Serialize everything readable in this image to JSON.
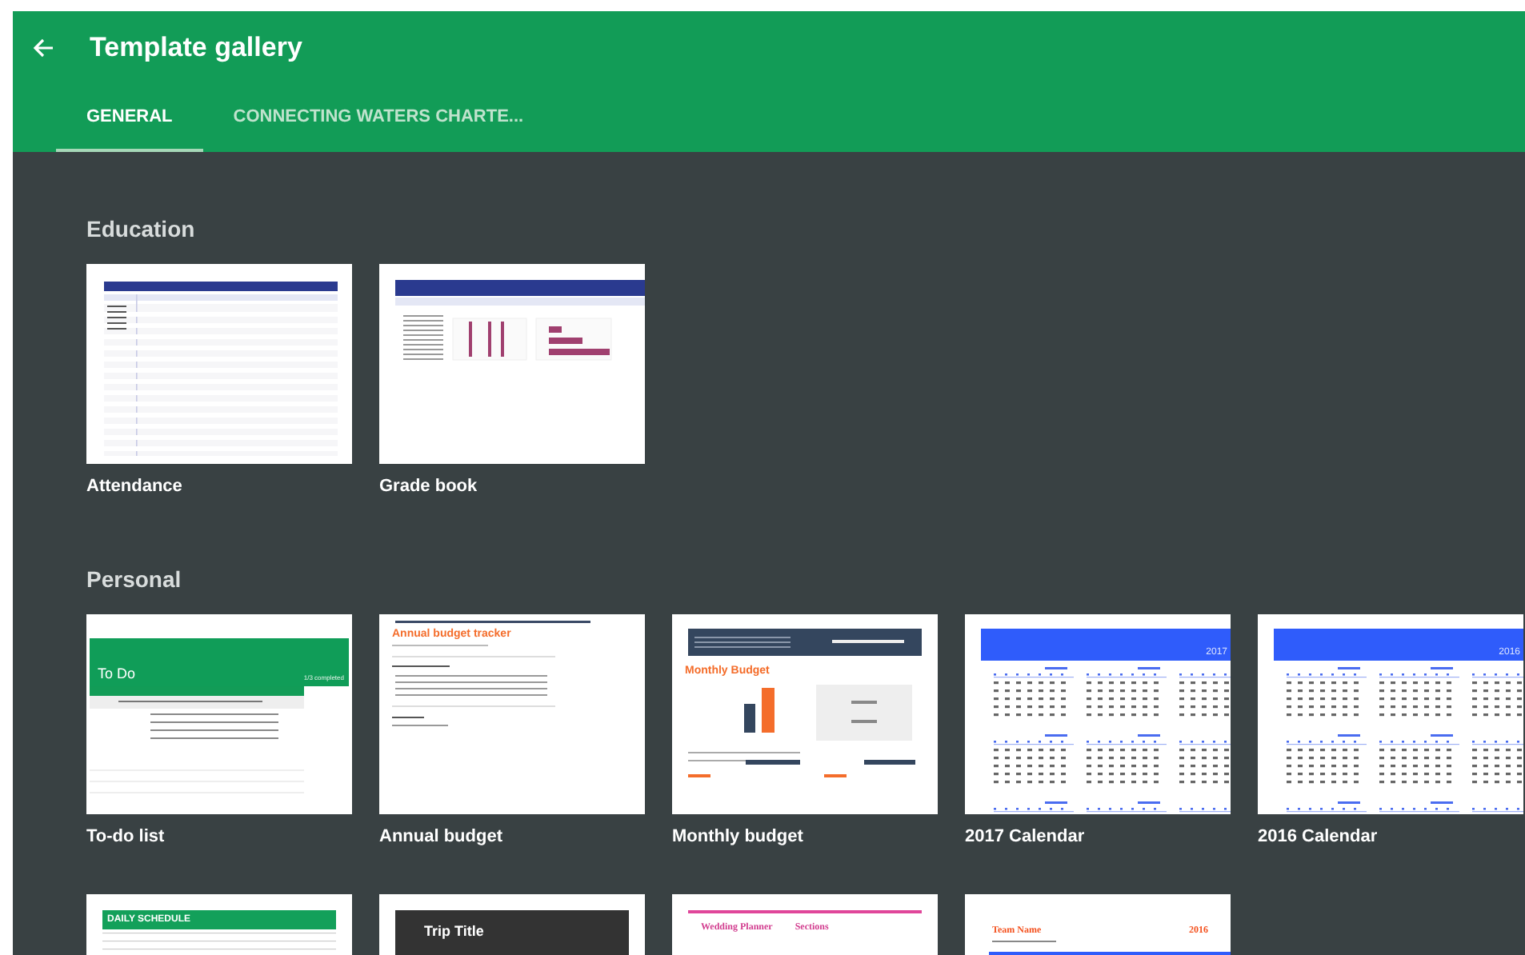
{
  "header": {
    "title": "Template gallery"
  },
  "tabs": [
    {
      "label": "GENERAL",
      "selected": true
    },
    {
      "label": "CONNECTING WATERS CHARTE...",
      "selected": false
    }
  ],
  "sections": [
    {
      "title": "Education",
      "templates": [
        {
          "name": "Attendance",
          "thumb": {
            "kind": "attendance"
          }
        },
        {
          "name": "Grade book",
          "thumb": {
            "kind": "gradebook"
          }
        }
      ]
    },
    {
      "title": "Personal",
      "templates": [
        {
          "name": "To-do list",
          "thumb": {
            "kind": "todo",
            "title": "To Do",
            "note": "1/3 completed"
          }
        },
        {
          "name": "Annual budget",
          "thumb": {
            "kind": "annual",
            "title": "Annual budget tracker"
          }
        },
        {
          "name": "Monthly budget",
          "thumb": {
            "kind": "monthly",
            "title": "Monthly Budget"
          }
        },
        {
          "name": "2017 Calendar",
          "thumb": {
            "kind": "calendar",
            "title": "2017"
          }
        },
        {
          "name": "2016 Calendar",
          "thumb": {
            "kind": "calendar",
            "title": "2016"
          }
        },
        {
          "thumb": {
            "kind": "schedule",
            "title": "DAILY SCHEDULE"
          }
        },
        {
          "thumb": {
            "kind": "trip",
            "title": "Trip Title"
          }
        },
        {
          "thumb": {
            "kind": "wedding",
            "title": "Wedding Planner",
            "note": "Sections"
          }
        },
        {
          "thumb": {
            "kind": "team",
            "title": "Team Name",
            "note": "2016"
          }
        }
      ]
    }
  ]
}
